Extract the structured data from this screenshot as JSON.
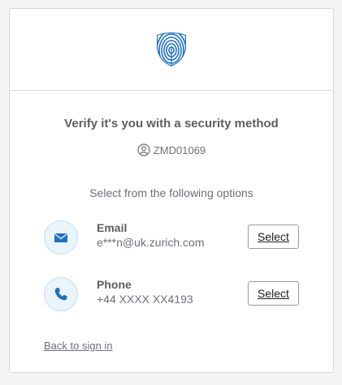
{
  "title": "Verify it's you with a security method",
  "identifier": {
    "value": "ZMD01069",
    "icon": "user-icon"
  },
  "subtitle": "Select from the following options",
  "options": [
    {
      "name": "Email",
      "detail": "e***n@uk.zurich.com",
      "icon": "envelope-icon",
      "button_label": "Select"
    },
    {
      "name": "Phone",
      "detail": "+44 XXXX XX4193",
      "icon": "phone-icon",
      "button_label": "Select"
    }
  ],
  "back_link": "Back to sign in",
  "logo": {
    "icon": "fingerprint-shield-icon",
    "color": "#1f70c1"
  },
  "colors": {
    "icon_bg": "#e9f4fb",
    "accent": "#1f70c1"
  }
}
